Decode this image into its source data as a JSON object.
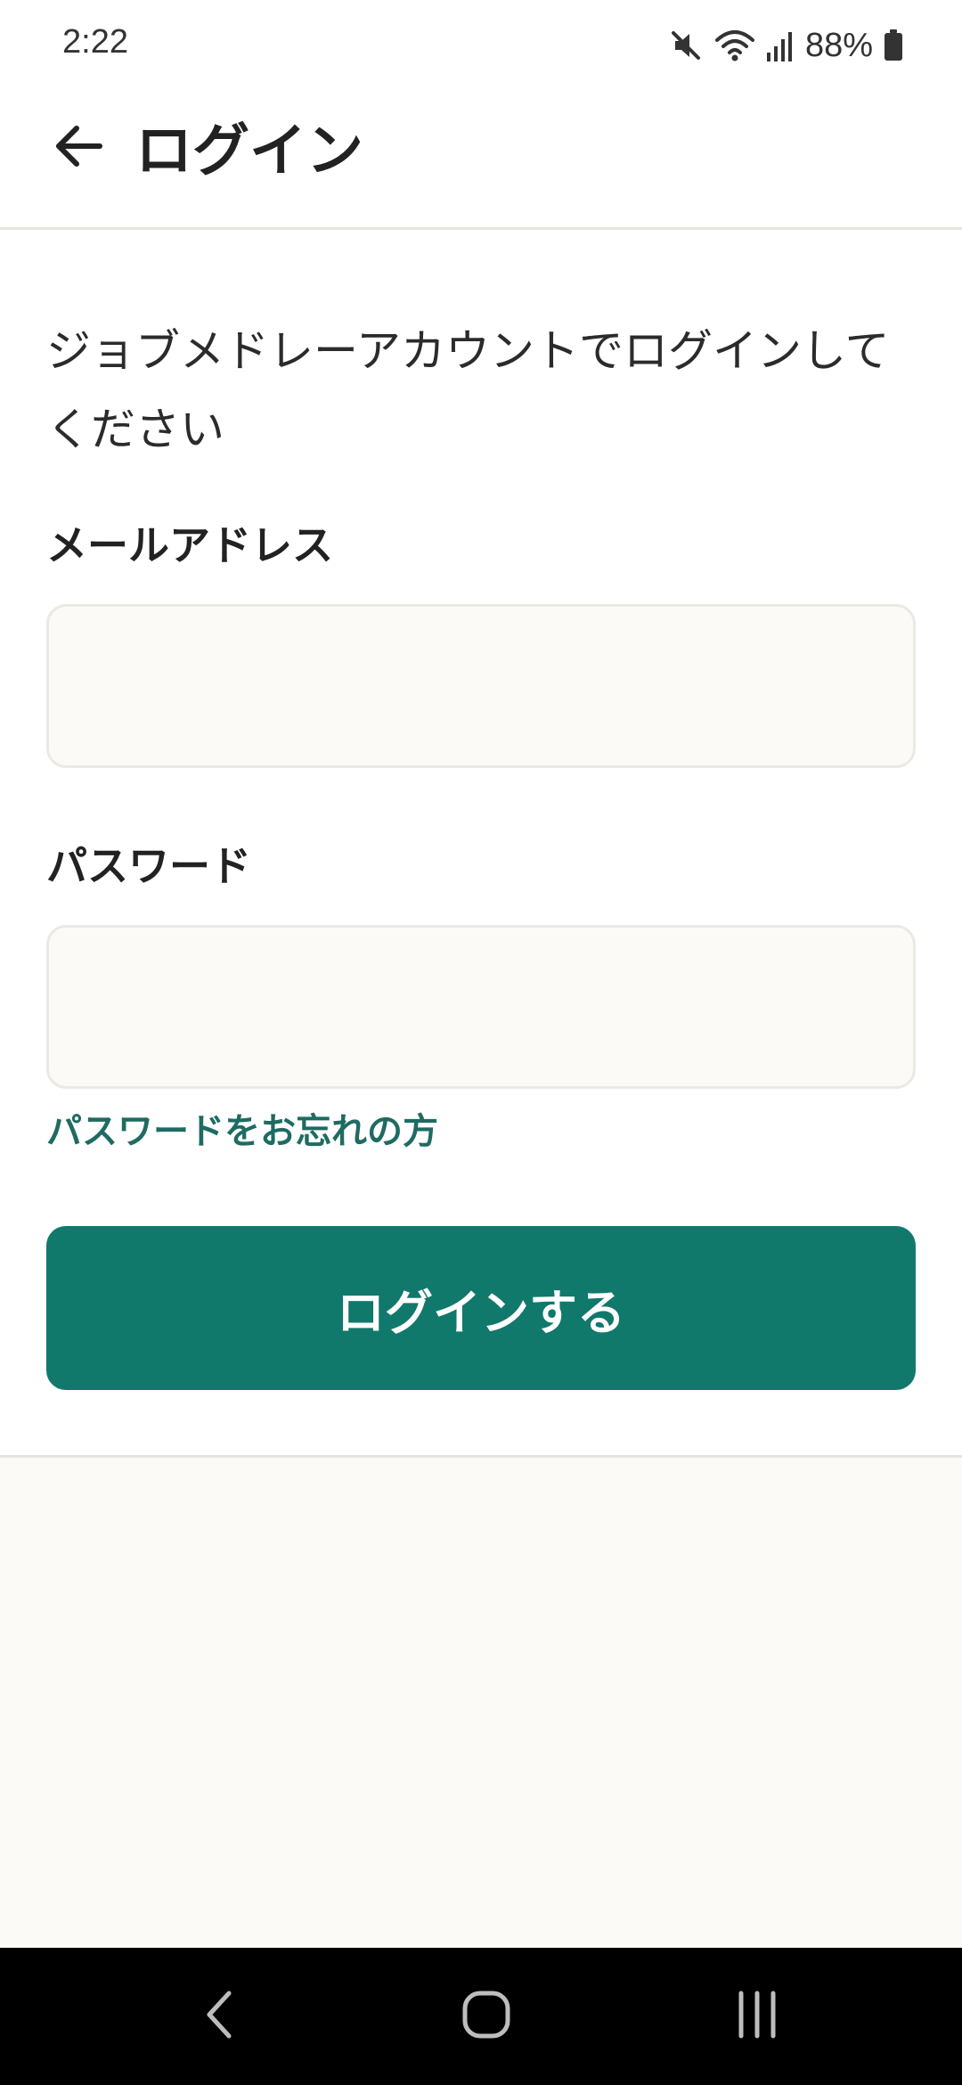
{
  "status_bar": {
    "time": "2:22",
    "battery": "88%",
    "icons": [
      "mute-icon",
      "wifi-icon",
      "signal-icon",
      "battery-icon"
    ]
  },
  "header": {
    "title": "ログイン",
    "back_icon": "arrow-left-icon"
  },
  "form": {
    "intro": "ジョブメドレーアカウントでログインしてください",
    "email_label": "メールアドレス",
    "email_value": "",
    "password_label": "パスワード",
    "password_value": "",
    "forgot_password": "パスワードをお忘れの方",
    "submit_label": "ログインする"
  },
  "colors": {
    "accent": "#11786c",
    "link": "#1e6b61",
    "input_background": "#fbfaf7",
    "lower_background": "#fbfaf6"
  },
  "nav_bar": {
    "icons": [
      "back-chevron-icon",
      "home-icon",
      "recents-icon"
    ]
  }
}
